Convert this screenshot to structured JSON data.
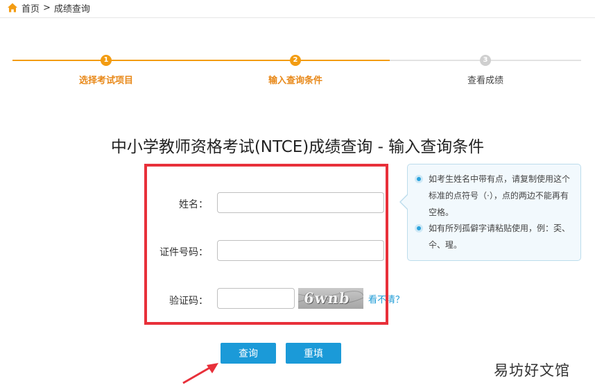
{
  "breadcrumb": {
    "home": "首页",
    "separator": ">",
    "current": "成绩查询",
    "icon": "home-icon"
  },
  "steps": [
    {
      "number": "1",
      "label": "选择考试项目",
      "state": "done"
    },
    {
      "number": "2",
      "label": "输入查询条件",
      "state": "active"
    },
    {
      "number": "3",
      "label": "查看成绩",
      "state": "pending"
    }
  ],
  "page_title": "中小学教师资格考试(NTCE)成绩查询 - 输入查询条件",
  "form": {
    "name_label": "姓名：",
    "name_value": "",
    "id_label": "证件号码：",
    "id_value": "",
    "captcha_label": "验证码：",
    "captcha_value": "",
    "captcha_image_text": "6wnb",
    "captcha_refresh": "看不清？"
  },
  "tips": [
    "如考生姓名中带有点，请复制使用这个标准的点符号（·），点的两边不能再有空格。",
    "如有所列孤僻字请粘贴使用，例：奀、仐、瑆。"
  ],
  "buttons": {
    "query": "查询",
    "reset": "重填"
  },
  "watermark": "易坊好文馆",
  "colors": {
    "accent_orange": "#f39c12",
    "primary_blue": "#1b9ad8",
    "highlight_red": "#e8303a",
    "tip_bg": "#f2f9fd"
  }
}
